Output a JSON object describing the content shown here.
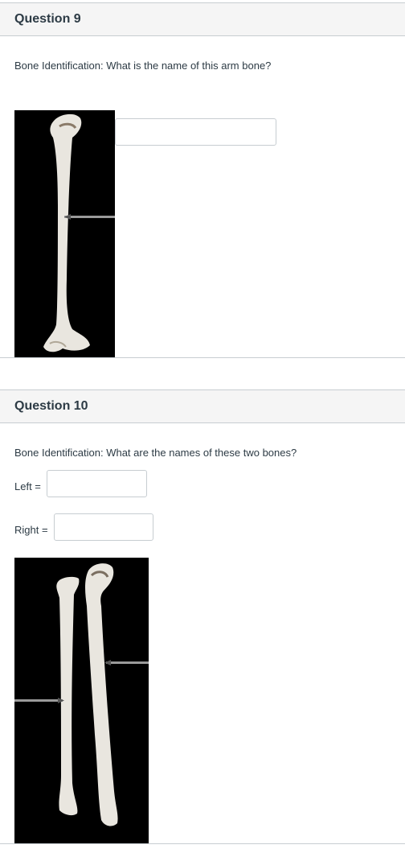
{
  "question9": {
    "title": "Question 9",
    "prompt": "Bone Identification: What is the name of this arm bone?",
    "answer_value": "",
    "image_icon": "humerus-image"
  },
  "question10": {
    "title": "Question 10",
    "prompt": "Bone Identification: What are the names of these two bones?",
    "left_label": "Left =",
    "left_value": "",
    "right_label": "Right =",
    "right_value": "",
    "image_icon": "forearm-bones-image"
  }
}
